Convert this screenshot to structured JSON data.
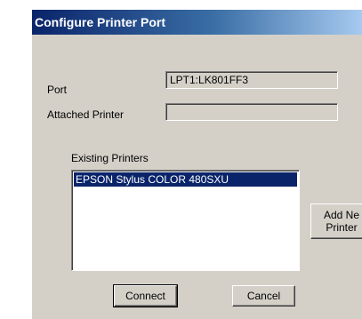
{
  "window": {
    "title": "Configure Printer Port"
  },
  "port": {
    "label": "Port",
    "value": "LPT1:LK801FF3"
  },
  "attached_printer": {
    "label": "Attached Printer",
    "value": ""
  },
  "existing_printers": {
    "label": "Existing Printers",
    "items": [
      "EPSON Stylus COLOR 480SXU"
    ],
    "selected_index": 0
  },
  "buttons": {
    "add_new_printer_line1": "Add Ne",
    "add_new_printer_line2": "Printer",
    "connect": "Connect",
    "cancel": "Cancel"
  },
  "colors": {
    "title_bar": "#0a246a",
    "dialog_face": "#d4d0c8",
    "selection": "#0a246a"
  }
}
